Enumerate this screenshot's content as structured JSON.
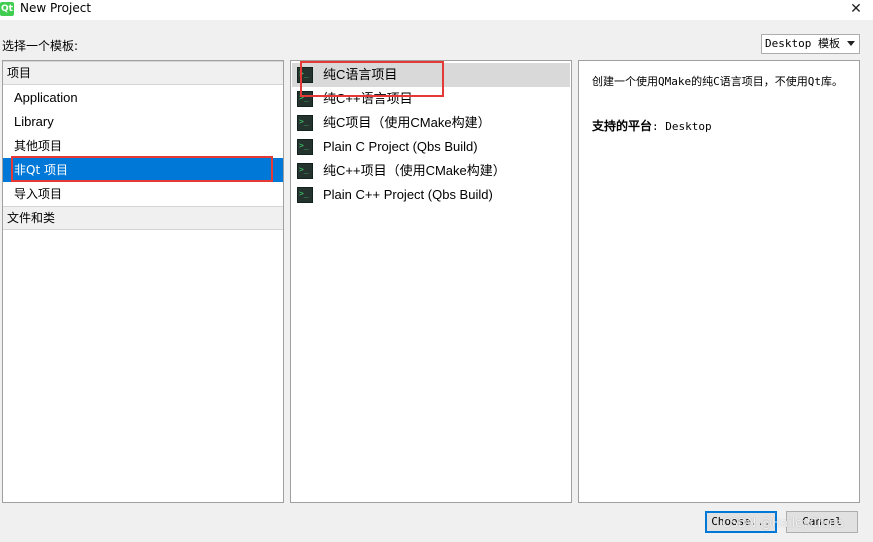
{
  "window": {
    "title": "New Project",
    "icon_text": "Qt",
    "close_glyph": "✕"
  },
  "template_label": "选择一个模板:",
  "platform_filter": {
    "selected": "Desktop 模板"
  },
  "categories": {
    "project_group": "项目",
    "items": [
      {
        "label": "Application"
      },
      {
        "label": "Library"
      },
      {
        "label": "其他项目"
      },
      {
        "label": "非Qt 项目",
        "selected": true
      },
      {
        "label": "导入项目"
      }
    ],
    "files_group": "文件和类"
  },
  "projects": [
    {
      "label": "纯C语言项目",
      "icon": "terminal-icon",
      "selected": true
    },
    {
      "label": "纯C++语言项目",
      "icon": "terminal-icon"
    },
    {
      "label": "纯C项目（使用CMake构建）",
      "icon": "terminal-icon"
    },
    {
      "label": "Plain C Project (Qbs Build)",
      "icon": "terminal-icon"
    },
    {
      "label": "纯C++项目（使用CMake构建）",
      "icon": "terminal-icon"
    },
    {
      "label": "Plain C++ Project (Qbs Build)",
      "icon": "terminal-icon"
    }
  ],
  "description": {
    "text": "创建一个使用QMake的纯C语言项目，不使用Qt库。",
    "platforms_label": "支持的平台",
    "platforms_value": ": Desktop"
  },
  "buttons": {
    "choose": "Choose...",
    "cancel": "Cancel"
  },
  "watermark": "CSDN @HaileyChina",
  "colors": {
    "selection_blue": "#0078d7",
    "annotation_red": "#e53935"
  }
}
